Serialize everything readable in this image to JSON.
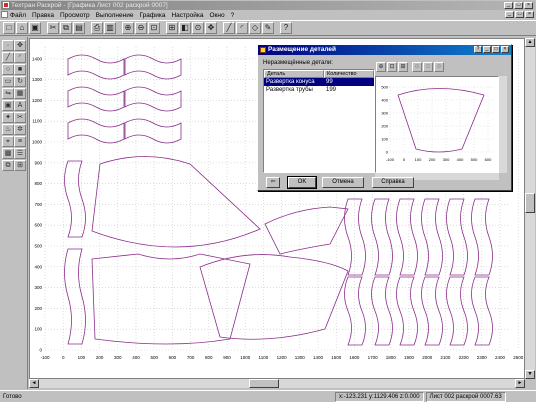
{
  "window": {
    "title": "Техтран   Раскрой - [Графика Лист 002 раскрой 0007]",
    "controls": [
      "_",
      "□",
      "×"
    ]
  },
  "menu": {
    "items": [
      "Файл",
      "Правка",
      "Просмотр",
      "Выполнение",
      "Графика",
      "Настройка",
      "Окно",
      "?"
    ]
  },
  "toolbar": {
    "buttons": [
      "new-icon",
      "open-icon",
      "save-icon",
      "sep",
      "cut-icon",
      "copy-icon",
      "paste-icon",
      "sep",
      "print-icon",
      "preview-icon",
      "sep",
      "zoom-in-icon",
      "zoom-out-icon",
      "zoom-fit-icon",
      "sep",
      "zoom-window-icon",
      "zoom-prev-icon",
      "zoom-all-icon",
      "pan-icon",
      "sep",
      "draw-line-icon",
      "draw-arc-icon",
      "draw-poly-icon",
      "edit-icon",
      "sep",
      "help-icon"
    ]
  },
  "drawing": {
    "y_ticks": [
      "1400",
      "1300",
      "1200",
      "1100",
      "1000",
      "900",
      "800",
      "700",
      "600",
      "500",
      "400",
      "300",
      "200",
      "100",
      "0"
    ],
    "x_ticks": [
      "-100",
      "0",
      "100",
      "200",
      "300",
      "400",
      "500",
      "600",
      "700",
      "800",
      "900",
      "1000",
      "1100",
      "1200",
      "1300",
      "1400",
      "1500",
      "1600",
      "1700",
      "1800",
      "1900",
      "2000",
      "2100",
      "2200",
      "2300",
      "2400",
      "2500"
    ],
    "part_color": "#8b2d8b"
  },
  "dialog": {
    "title": "Размещение деталей",
    "list_label": "Неразмещённые детали:",
    "columns": [
      "Деталь",
      "Количество"
    ],
    "rows": [
      {
        "name": "Развертка конуса",
        "qty": "99"
      },
      {
        "name": "Развертка трубы",
        "qty": "199"
      }
    ],
    "preview_y_ticks": [
      "500",
      "400",
      "300",
      "200",
      "100",
      "0"
    ],
    "preview_x_ticks": [
      "-100",
      "0",
      "100",
      "200",
      "300",
      "400",
      "500",
      "600"
    ],
    "buttons": {
      "ok": "OK",
      "cancel": "Отмена",
      "help": "Справка"
    }
  },
  "status": {
    "text": "Готово",
    "coords": "x:-123.231 y:1129.406 z:0.000",
    "sheet": "Лист 002 раскрой 0007.63"
  }
}
